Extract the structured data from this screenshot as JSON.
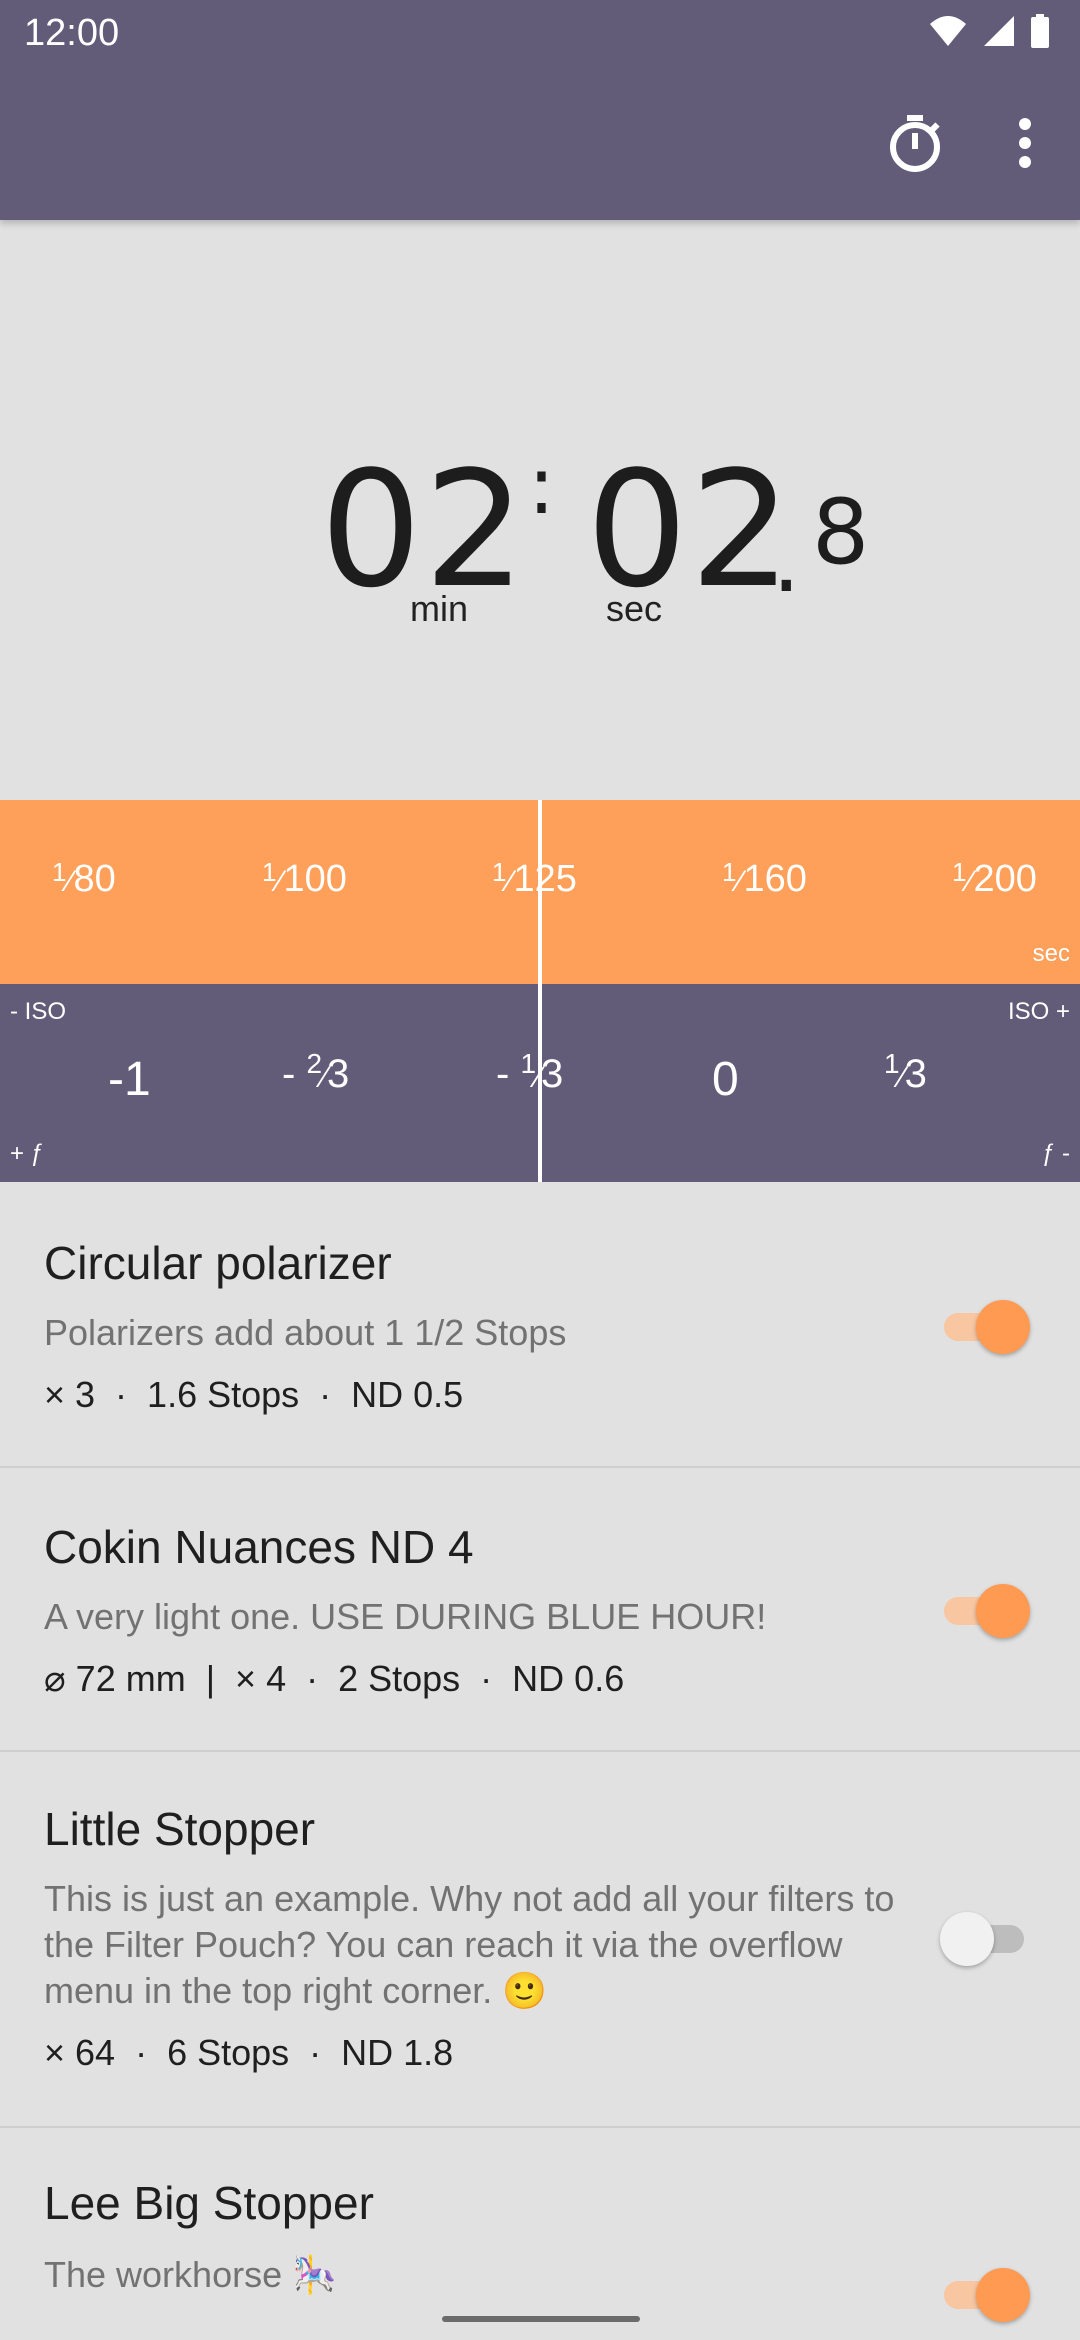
{
  "status_bar": {
    "time": "12:00",
    "icons": [
      "wifi-icon",
      "cellular-signal-icon",
      "battery-icon"
    ]
  },
  "app_bar": {
    "actions": [
      "stopwatch-icon",
      "more-vert-icon"
    ]
  },
  "timer": {
    "minutes": "02",
    "separator": ":",
    "seconds": "02",
    "decimal_point": ".",
    "tenths": "8",
    "min_label": "min",
    "sec_label": "sec"
  },
  "shutter_scale": {
    "values": [
      {
        "num": "1",
        "den": "80"
      },
      {
        "num": "1",
        "den": "100"
      },
      {
        "num": "1",
        "den": "125"
      },
      {
        "num": "1",
        "den": "160"
      },
      {
        "num": "1",
        "den": "200"
      }
    ],
    "unit": "sec"
  },
  "iso_scale": {
    "iso_minus_label": "- ISO",
    "iso_plus_label": "ISO +",
    "f_plus_label": "+ ƒ",
    "f_minus_label": "ƒ -",
    "values": [
      {
        "whole": "-1",
        "num": "",
        "den": ""
      },
      {
        "whole": "- ",
        "num": "2",
        "den": "3"
      },
      {
        "whole": "- ",
        "num": "1",
        "den": "3"
      },
      {
        "whole": "0",
        "num": "",
        "den": ""
      },
      {
        "whole": "",
        "num": "1",
        "den": "3"
      }
    ]
  },
  "filters": [
    {
      "title": "Circular polarizer",
      "description": "Polarizers add about 1 1/2 Stops",
      "meta": "× 3  ·  1.6 Stops  ·  ND 0.5",
      "enabled": true
    },
    {
      "title": "Cokin Nuances ND 4",
      "description": "A very light one. USE DURING BLUE HOUR!",
      "meta": "⌀ 72 mm  |  × 4  ·  2 Stops  ·  ND 0.6",
      "enabled": true
    },
    {
      "title": "Little Stopper",
      "description": "This is just an example. Why not add all your filters to the Filter Pouch? You can reach it via the overflow menu in the top right corner. 🙂",
      "meta": "× 64  ·  6 Stops  ·  ND 1.8",
      "enabled": false
    },
    {
      "title": "Lee Big Stopper",
      "description": "The workhorse 🎠",
      "meta": "",
      "enabled": true
    }
  ],
  "colors": {
    "primary": "#625c79",
    "accent": "#ffa05a",
    "background": "#e1e1e1"
  }
}
